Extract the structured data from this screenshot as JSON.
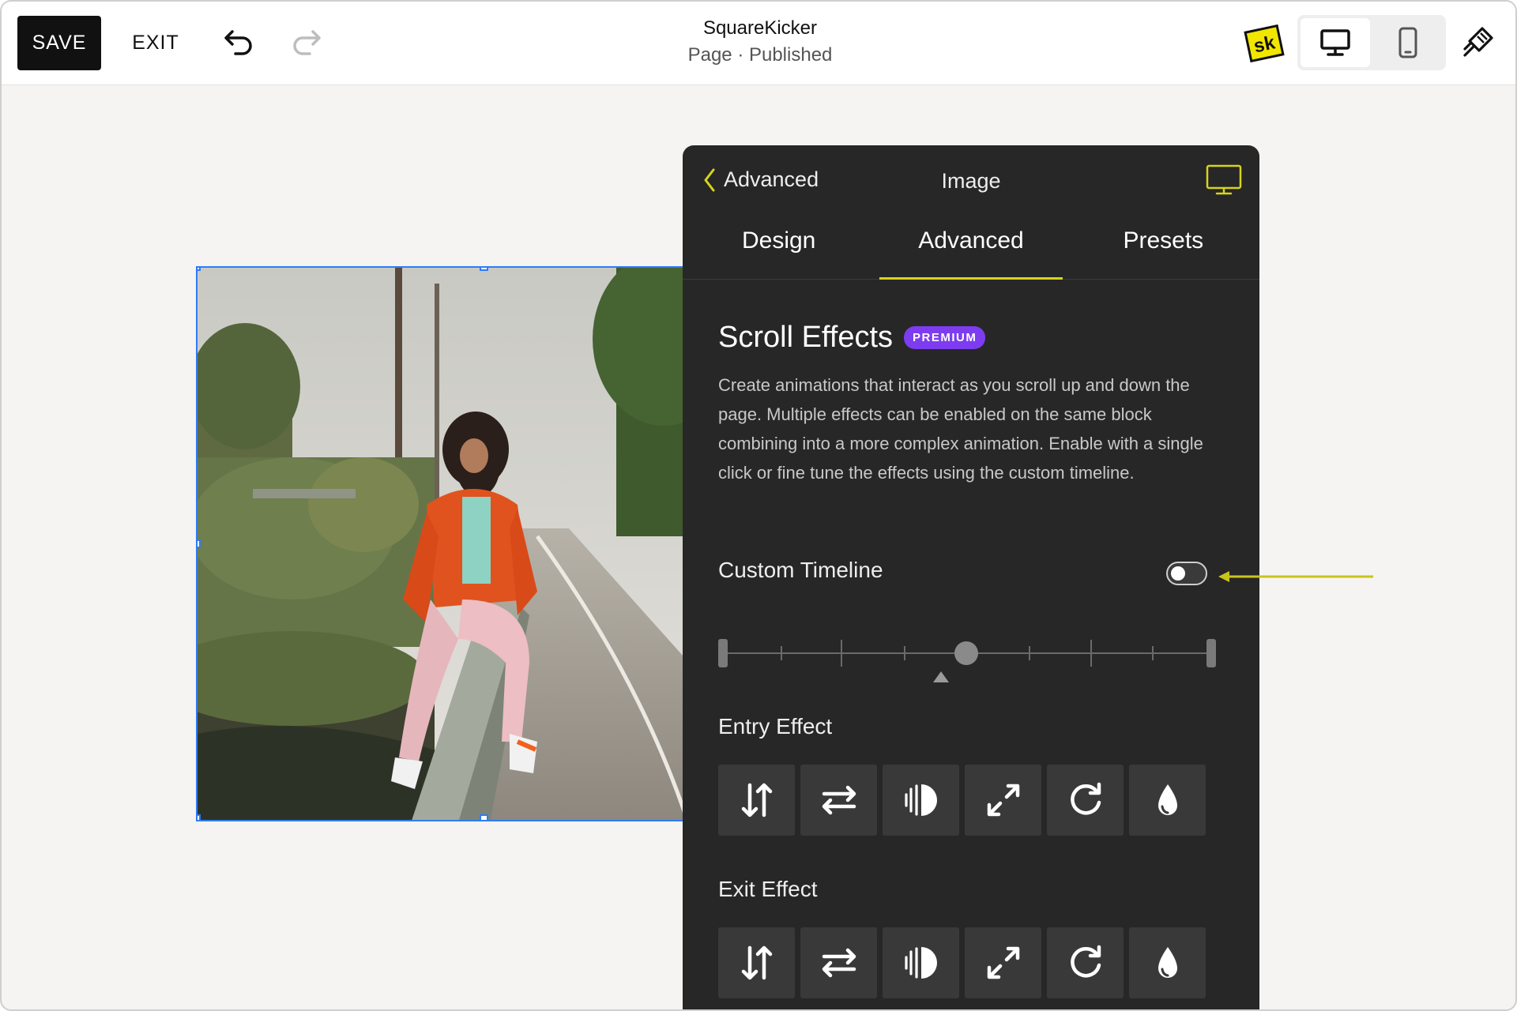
{
  "toolbar": {
    "save_label": "SAVE",
    "exit_label": "EXIT",
    "site_name": "SquareKicker",
    "page_status": "Page · Published",
    "logo_text": "sk"
  },
  "panel": {
    "back_label": "Advanced",
    "title": "Image",
    "tabs": [
      "Design",
      "Advanced",
      "Presets"
    ],
    "active_tab": "Advanced",
    "section_title": "Scroll Effects",
    "badge": "PREMIUM",
    "description": "Create animations that interact as you scroll up and down the page. Multiple effects can be enabled on the same block combining into a more complex animation. Enable with a single click or fine tune the effects using the custom timeline.",
    "custom_timeline_label": "Custom Timeline",
    "custom_timeline_on": false,
    "entry_label": "Entry Effect",
    "exit_label": "Exit Effect",
    "effects": [
      "vertical-move-icon",
      "horizontal-move-icon",
      "opacity-icon",
      "scale-icon",
      "rotate-icon",
      "blur-icon"
    ]
  },
  "colors": {
    "accent": "#d8d31a",
    "premium": "#7d3cf0",
    "panel_bg": "#272727",
    "selection": "#2f7bf5"
  }
}
